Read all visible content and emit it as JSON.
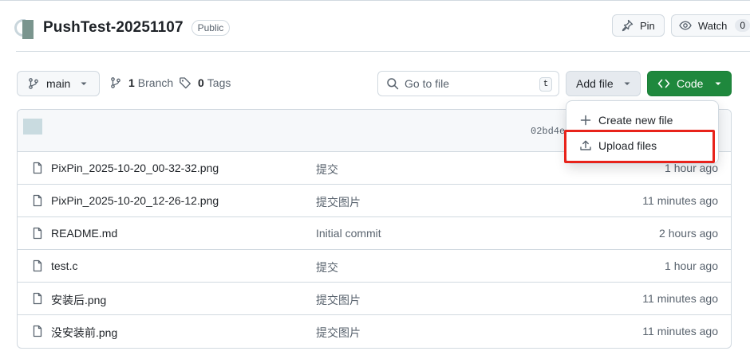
{
  "repo": {
    "name": "PushTest-20251107",
    "visibility": "Public"
  },
  "actions": {
    "pin_label": "Pin",
    "watch_label": "Watch",
    "watch_count": "0"
  },
  "toolbar": {
    "branch_name": "main",
    "branch_count": "1",
    "branch_label": "Branch",
    "tag_count": "0",
    "tag_label": "Tags",
    "search_placeholder": "Go to file",
    "search_shortcut": "t",
    "add_file_label": "Add file",
    "code_label": "Code"
  },
  "latest_commit": {
    "sha": "02bd4ec"
  },
  "add_file_menu": {
    "items": [
      {
        "label": "Create new file",
        "icon": "plus-icon"
      },
      {
        "label": "Upload files",
        "icon": "upload-icon"
      }
    ]
  },
  "files": [
    {
      "name": "PixPin_2025-10-20_00-32-32.png",
      "message": "提交",
      "time": "1 hour ago"
    },
    {
      "name": "PixPin_2025-10-20_12-26-12.png",
      "message": "提交图片",
      "time": "11 minutes ago"
    },
    {
      "name": "README.md",
      "message": "Initial commit",
      "time": "2 hours ago"
    },
    {
      "name": "test.c",
      "message": "提交",
      "time": "1 hour ago"
    },
    {
      "name": "安装后.png",
      "message": "提交图片",
      "time": "11 minutes ago"
    },
    {
      "name": "没安装前.png",
      "message": "提交图片",
      "time": "11 minutes ago"
    }
  ],
  "colors": {
    "primary_button": "#1f883d",
    "highlight": "#e8231b",
    "border": "#d1d9e0",
    "muted_text": "#59636e"
  }
}
